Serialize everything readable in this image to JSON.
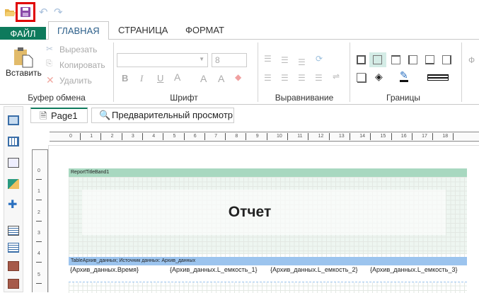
{
  "qat": {
    "icons": [
      "open-folder-icon",
      "save-icon",
      "undo-icon",
      "redo-icon"
    ],
    "highlight_color": "#e00000"
  },
  "tabs": {
    "file": "ФАЙЛ",
    "home": "ГЛАВНАЯ",
    "page": "СТРАНИЦА",
    "format": "ФОРМАТ"
  },
  "clipboard": {
    "paste": "Вставить",
    "cut": "Вырезать",
    "copy": "Копировать",
    "delete": "Удалить",
    "label": "Буфер обмена"
  },
  "font": {
    "family": "",
    "size": "8",
    "bold": "B",
    "italic": "I",
    "underline": "U",
    "color": "A",
    "grow": "A",
    "shrink": "A",
    "label": "Шрифт"
  },
  "alignment": {
    "label": "Выравнивание"
  },
  "borders": {
    "label": "Границы"
  },
  "format_group": {
    "label_partial": "Ф"
  },
  "page_tabs": {
    "page1": "Page1",
    "preview": "Предварительный просмотр"
  },
  "ruler": {
    "h": [
      "0",
      "1",
      "2",
      "3",
      "4",
      "5",
      "6",
      "7",
      "8",
      "9",
      "10",
      "11",
      "12",
      "13",
      "14",
      "15",
      "16",
      "17",
      "18"
    ],
    "v": [
      "0",
      "1",
      "2",
      "3",
      "4",
      "5"
    ]
  },
  "report": {
    "title_band": "ReportTitleBand1",
    "title_text": "Отчет",
    "table_band": "TableАрхив_данных; Источник данных: Архив_данных",
    "cells": [
      "{Архив_данных.Время}",
      "{Архив_данных.L_емкость_1}",
      "{Архив_данных.L_емкость_2}",
      "{Архив_данных.L_емкость_3}"
    ],
    "title_band_color": "#a8d8c0",
    "table_band_color": "#9cc4ee"
  }
}
